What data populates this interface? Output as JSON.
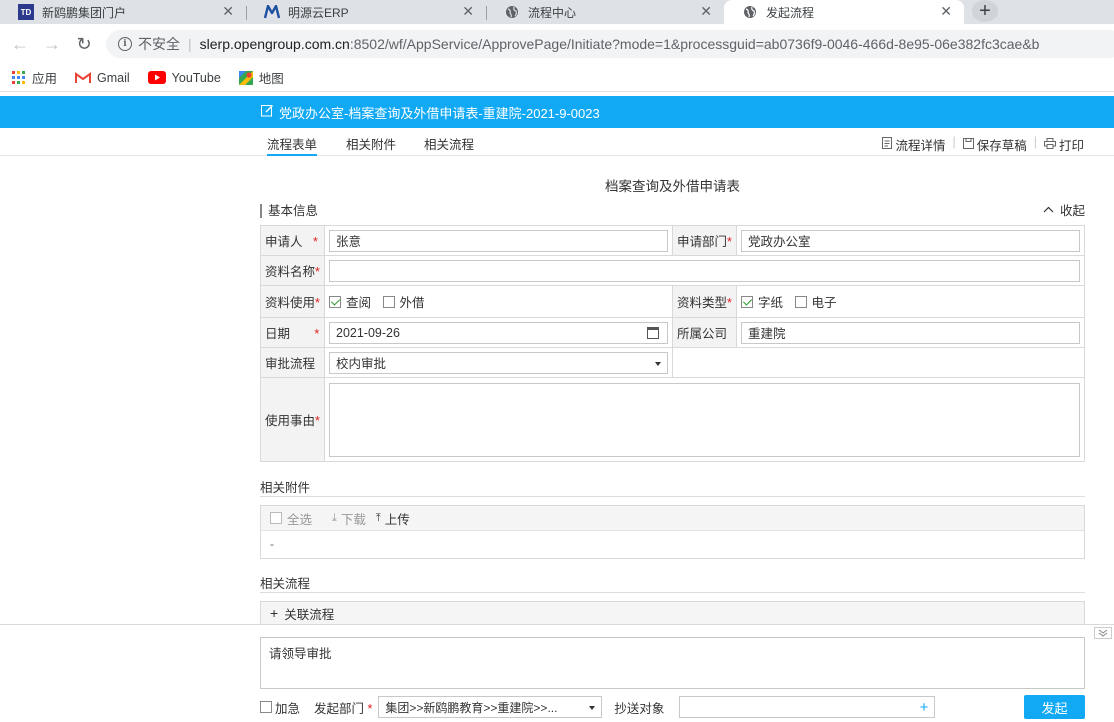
{
  "browser": {
    "tabs": [
      {
        "title": "新鸥鹏集团门户",
        "icon": "td-icon"
      },
      {
        "title": "明源云ERP",
        "icon": "m-logo-icon"
      },
      {
        "title": "流程中心",
        "icon": "globe-icon"
      },
      {
        "title": "发起流程",
        "icon": "globe-icon"
      }
    ],
    "address": {
      "security": "不安全",
      "host": "slerp.opengroup.com.cn",
      "path": ":8502/wf/AppService/ApprovePage/Initiate?mode=1&processguid=ab0736f9-0046-466d-8e95-06e382fc3cae&b"
    },
    "bookmarks": [
      {
        "label": "应用",
        "icon": "apps-grid-icon"
      },
      {
        "label": "Gmail",
        "icon": "gmail-icon"
      },
      {
        "label": "YouTube",
        "icon": "youtube-icon"
      },
      {
        "label": "地图",
        "icon": "maps-icon"
      }
    ]
  },
  "header": {
    "title": "党政办公室-档案查询及外借申请表-重建院-2021-9-0023"
  },
  "form_tabs": [
    "流程表单",
    "相关附件",
    "相关流程"
  ],
  "toolbar": {
    "detail": "流程详情",
    "save_draft": "保存草稿",
    "print": "打印"
  },
  "form": {
    "title": "档案查询及外借申请表",
    "section_basic": "基本信息",
    "collapse": "收起",
    "applicant_label": "申请人",
    "applicant_value": "张意",
    "dept_label": "申请部门",
    "dept_value": "党政办公室",
    "material_name_label": "资料名称",
    "material_name_value": "",
    "usage_label": "资料使用",
    "usage_options": [
      {
        "label": "查阅",
        "checked": true
      },
      {
        "label": "外借",
        "checked": false
      }
    ],
    "type_label": "资料类型",
    "type_options": [
      {
        "label": "字纸",
        "checked": true
      },
      {
        "label": "电子",
        "checked": false
      }
    ],
    "date_label": "日期",
    "date_value": "2021-09-26",
    "company_label": "所属公司",
    "company_value": "重建院",
    "flow_label": "审批流程",
    "flow_value": "校内审批",
    "reason_label": "使用事由",
    "reason_value": ""
  },
  "attachments": {
    "heading": "相关附件",
    "select_all": "全选",
    "download": "下载",
    "upload": "上传",
    "empty": "-"
  },
  "related": {
    "heading": "相关流程",
    "add": "关联流程"
  },
  "bottom": {
    "comment": "请领导审批",
    "urgent": "加急",
    "dept_label": "发起部门",
    "dept_value": "集团>>新鸥鹏教育>>重建院>>...",
    "cc_label": "抄送对象",
    "cc_value": "",
    "submit": "发起"
  },
  "colors": {
    "accent": "#12a9f4",
    "required": "#e02020"
  }
}
